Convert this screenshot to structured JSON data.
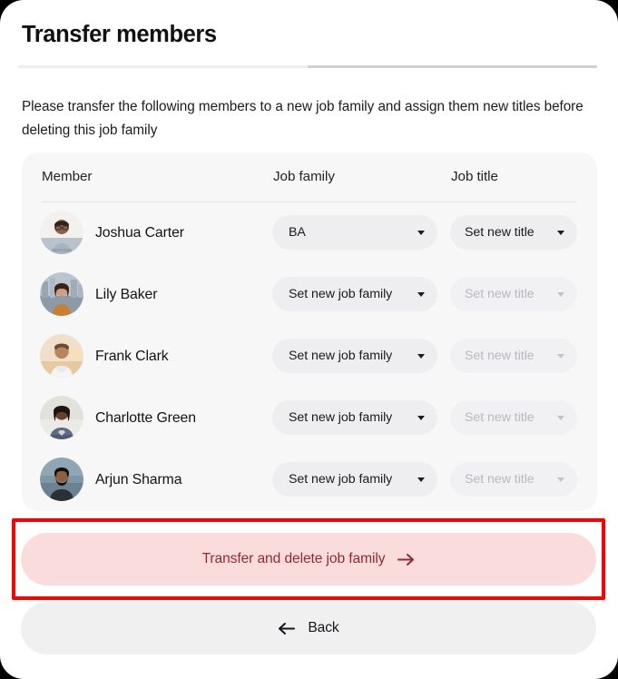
{
  "header": {
    "title": "Transfer members",
    "progress_percent": 50
  },
  "intro": "Please transfer the following members to a new job family and assign them new titles before deleting this job family",
  "table": {
    "columns": [
      "Member",
      "Job family",
      "Job title"
    ],
    "rows": [
      {
        "name": "Joshua Carter",
        "job_family": "BA",
        "job_family_placeholder": "Set new job family",
        "job_title": "Set new title",
        "job_title_disabled": false,
        "avatar": "photo-man-glasses-arms-crossed"
      },
      {
        "name": "Lily Baker",
        "job_family": "Set new job family",
        "job_family_placeholder": "Set new job family",
        "job_title": "Set new title",
        "job_title_disabled": true,
        "avatar": "photo-woman-city-background"
      },
      {
        "name": "Frank Clark",
        "job_family": "Set new job family",
        "job_family_placeholder": "Set new job family",
        "job_title": "Set new title",
        "job_title_disabled": true,
        "avatar": "photo-man-beard-white-shirt"
      },
      {
        "name": "Charlotte Green",
        "job_family": "Set new job family",
        "job_family_placeholder": "Set new job family",
        "job_title": "Set new title",
        "job_title_disabled": true,
        "avatar": "photo-woman-arms-crossed"
      },
      {
        "name": "Arjun Sharma",
        "job_family": "Set new job family",
        "job_family_placeholder": "Set new job family",
        "job_title": "Set new title",
        "job_title_disabled": true,
        "avatar": "photo-man-beard-dark-jacket"
      }
    ]
  },
  "footer": {
    "transfer_label": "Transfer and delete job family",
    "transfer_icon": "arrow-right-icon",
    "back_label": "Back",
    "back_icon": "arrow-left-icon"
  },
  "colors": {
    "page_background": "#000000",
    "card_background": "#ffffff",
    "table_background": "#f7f7f8",
    "dropdown_background": "#eeeef0",
    "dropdown_disabled_text": "#b9b9be",
    "danger_button_background": "#fbdcdd",
    "danger_button_text": "#8e2a31",
    "back_button_background": "#f0f0f1",
    "progress_filled": "#eeeeef",
    "progress_track": "#cfcfd6",
    "annotation_outline": "#fe0000"
  }
}
